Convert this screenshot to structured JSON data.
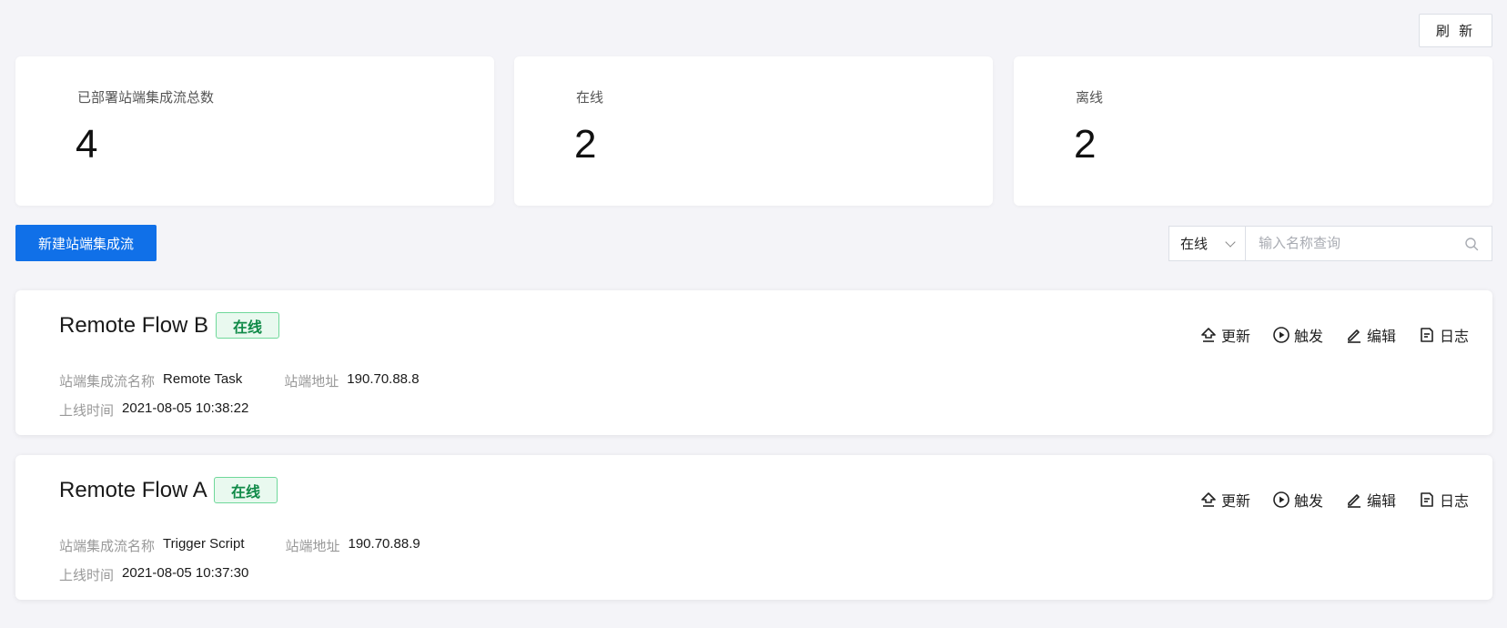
{
  "toolbar": {
    "refresh_label": "刷 新"
  },
  "stats": {
    "total": {
      "label": "已部署站端集成流总数",
      "value": "4"
    },
    "online": {
      "label": "在线",
      "value": "2"
    },
    "offline": {
      "label": "离线",
      "value": "2"
    }
  },
  "actions_bar": {
    "new_label": "新建站端集成流",
    "status_filter": {
      "selected": "在线"
    },
    "search": {
      "placeholder": "输入名称查询",
      "value": ""
    }
  },
  "flows": [
    {
      "title": "Remote Flow B",
      "status": "在线",
      "name_label": "站端集成流名称",
      "name_value": "Remote Task",
      "address_label": "站端地址",
      "address_value": "190.70.88.8",
      "time_label": "上线时间",
      "time_value": "2021-08-05 10:38:22",
      "actions": {
        "update": "更新",
        "trigger": "触发",
        "edit": "编辑",
        "log": "日志"
      }
    },
    {
      "title": "Remote Flow A",
      "status": "在线",
      "name_label": "站端集成流名称",
      "name_value": "Trigger Script",
      "address_label": "站端地址",
      "address_value": "190.70.88.9",
      "time_label": "上线时间",
      "time_value": "2021-08-05 10:37:30",
      "actions": {
        "update": "更新",
        "trigger": "触发",
        "edit": "编辑",
        "log": "日志"
      }
    }
  ],
  "colors": {
    "primary": "#1070e8",
    "online_tag_bg": "#e9f9ef",
    "online_tag_border": "#6fd89a",
    "online_tag_text": "#0f8a47",
    "page_bg": "#f4f4f8"
  }
}
